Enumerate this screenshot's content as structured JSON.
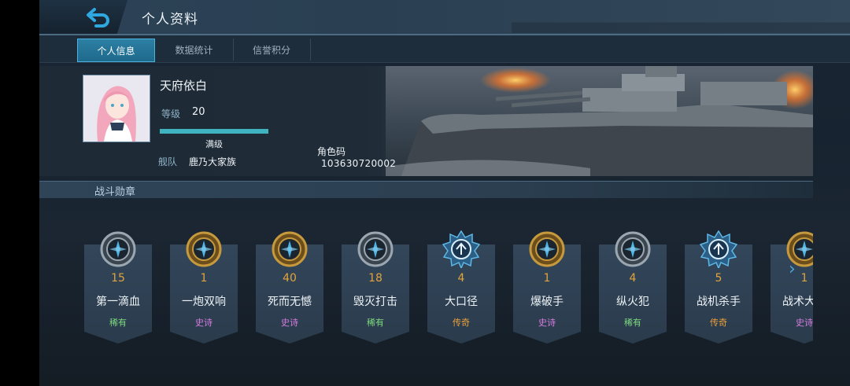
{
  "header": {
    "title": "个人资料",
    "back_icon": "back-arrow-icon"
  },
  "tabs": [
    {
      "label": "个人信息",
      "active": true
    },
    {
      "label": "数据统计",
      "active": false
    },
    {
      "label": "信誉积分",
      "active": false
    }
  ],
  "profile": {
    "nickname": "天府依白",
    "level_label": "等级",
    "level_value": "20",
    "exp_progress": 1.0,
    "max_label": "满级",
    "fleet_label": "舰队",
    "fleet_value": "鹿乃大家族",
    "role_code_label": "角色码",
    "role_code_value": "103630720002"
  },
  "section": {
    "title": "战斗勋章"
  },
  "colors": {
    "accent": "#2d8ab0",
    "count": "#e1a43c",
    "rare": "#7fd97f",
    "epic": "#d77ce0",
    "legendary": "#f0a23a"
  },
  "medals": [
    {
      "count": "15",
      "name": "第一滴血",
      "rarity": "稀有",
      "tier": "rare",
      "icon": "medal-silver-icon"
    },
    {
      "count": "1",
      "name": "一炮双响",
      "rarity": "史诗",
      "tier": "epic",
      "icon": "medal-gold-icon"
    },
    {
      "count": "40",
      "name": "死而无憾",
      "rarity": "史诗",
      "tier": "epic",
      "icon": "medal-gold-icon"
    },
    {
      "count": "18",
      "name": "毁灭打击",
      "rarity": "稀有",
      "tier": "rare",
      "icon": "medal-silver-icon"
    },
    {
      "count": "4",
      "name": "大口径",
      "rarity": "传奇",
      "tier": "legendary",
      "icon": "medal-star-icon"
    },
    {
      "count": "1",
      "name": "爆破手",
      "rarity": "史诗",
      "tier": "epic",
      "icon": "medal-gold-icon"
    },
    {
      "count": "4",
      "name": "纵火犯",
      "rarity": "稀有",
      "tier": "rare",
      "icon": "medal-silver-icon"
    },
    {
      "count": "5",
      "name": "战机杀手",
      "rarity": "传奇",
      "tier": "legendary",
      "icon": "medal-star-icon"
    },
    {
      "count": "1",
      "name": "战术大师",
      "rarity": "史诗",
      "tier": "epic",
      "icon": "medal-gold-icon"
    }
  ]
}
